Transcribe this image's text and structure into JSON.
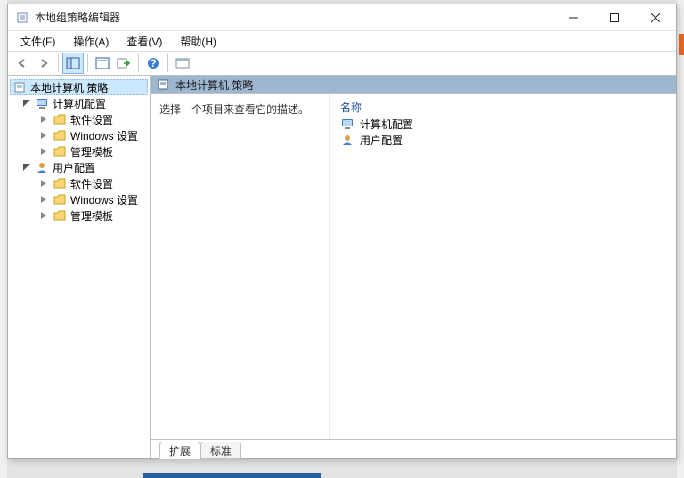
{
  "window": {
    "title": "本地组策略编辑器"
  },
  "menu": {
    "file": "文件(F)",
    "action": "操作(A)",
    "view": "查看(V)",
    "help": "帮助(H)"
  },
  "tree": {
    "root": "本地计算机 策略",
    "computer": "计算机配置",
    "user": "用户配置",
    "software": "软件设置",
    "windows": "Windows 设置",
    "admin": "管理模板"
  },
  "header": {
    "title": "本地计算机 策略"
  },
  "description": "选择一个项目来查看它的描述。",
  "list": {
    "col_name": "名称",
    "rows": [
      {
        "label": "计算机配置"
      },
      {
        "label": "用户配置"
      }
    ]
  },
  "tabs": {
    "extended": "扩展",
    "standard": "标准"
  }
}
